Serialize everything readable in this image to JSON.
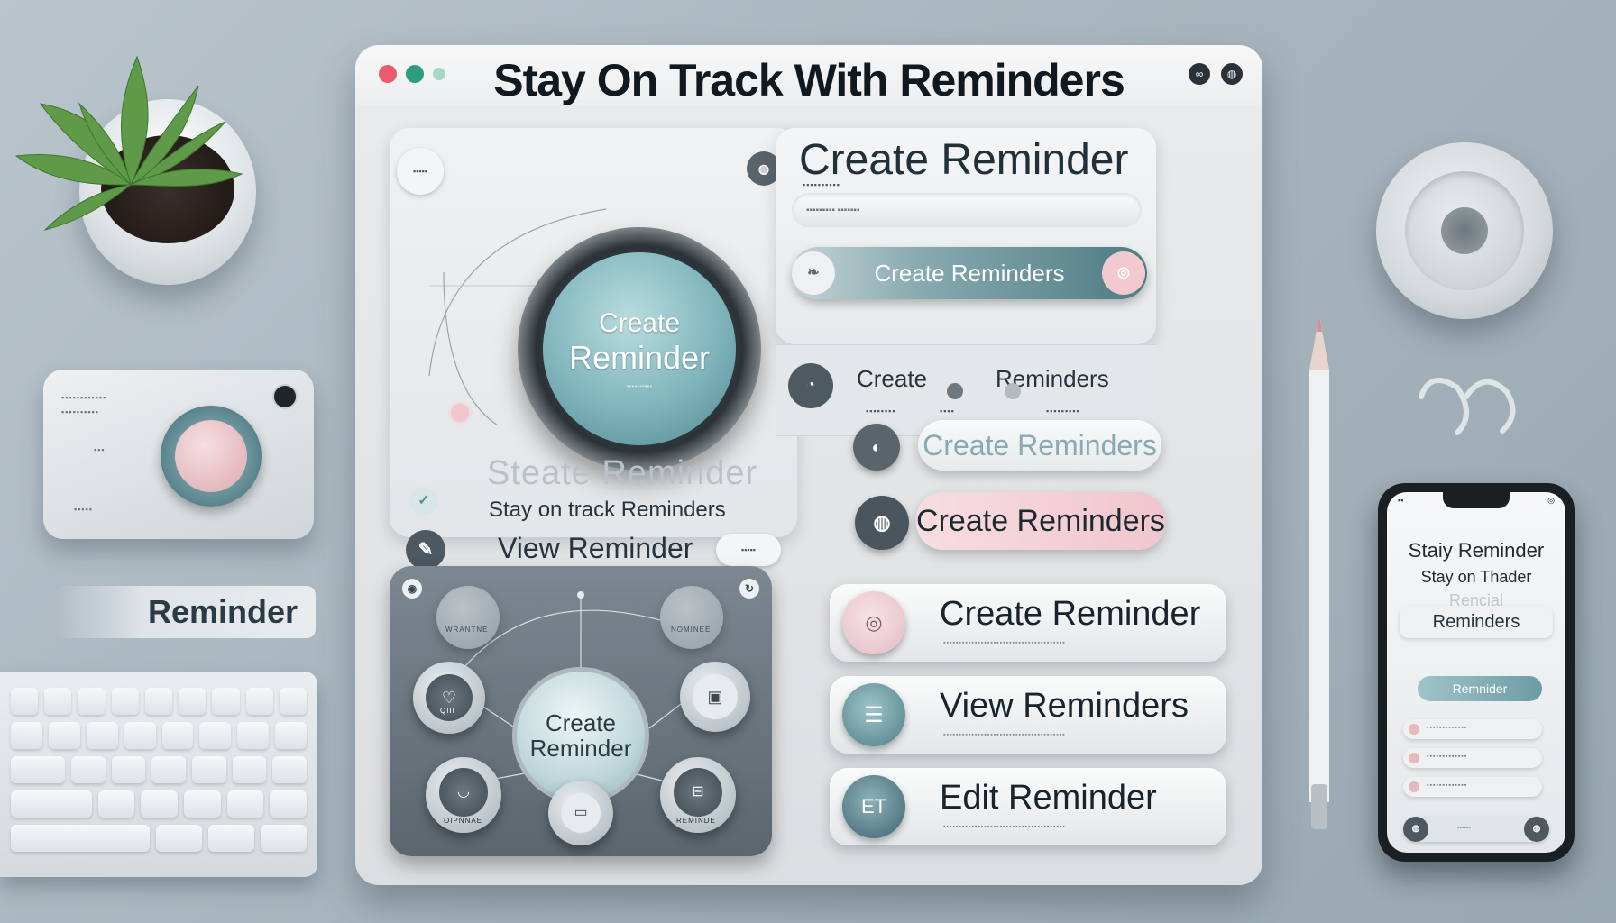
{
  "window": {
    "title": "Stay On Track With Reminders",
    "traffic_lights": [
      "#ea5c6c",
      "#2e9c7e",
      "#a8d8c4"
    ],
    "toolbar_icons": [
      "link-icon",
      "settings-icon"
    ]
  },
  "left_card": {
    "top_pill": "▪▪▪▪▪",
    "big_button": {
      "line1": "Create",
      "line2": "Reminder",
      "sub": "▪▪▪▪▪▪▪▪▪▪"
    },
    "ghost_heading": "Steate Reminder",
    "subtitle": "Stay on track Reminders",
    "view_label": "View Reminder",
    "view_pill": "▪▪▪▪▪"
  },
  "dark_card": {
    "center": {
      "line1": "Create",
      "line2": "Reminder"
    },
    "labels": [
      "WRANTNE",
      "NOMINEE",
      "QIII",
      "OIPNNAE",
      "REMINDE"
    ]
  },
  "right_top": {
    "title": "Create Reminder",
    "field_label": "▪▪▪▪▪▪▪▪▪▪",
    "field_value": "▪▪▪▪▪▪▪▪▪ ▪▪▪▪▪▪▪",
    "gradient_button": "Create Reminders"
  },
  "right_mid": {
    "left_word": "Create",
    "right_word": "Reminders",
    "tiny": [
      "▪▪▪▪▪▪▪▪",
      "▪▪▪▪",
      "▪▪▪▪▪▪▪▪▪"
    ]
  },
  "pill_buttons": [
    {
      "label": "Create  Reminders"
    },
    {
      "label": "Create  Reminders"
    }
  ],
  "list_buttons": [
    {
      "label": "Create Reminder",
      "sub": "▪▪▪▪▪▪▪▪▪▪▪▪▪▪▪▪▪▪▪▪▪▪▪▪▪▪▪▪▪▪▪▪▪▪▪▪▪▪▪",
      "icon": "clock-icon",
      "icon_text": "◎",
      "icon_bg": "#e2bcc3"
    },
    {
      "label": "View Reminders",
      "sub": "▪▪▪▪▪▪▪▪▪▪▪▪▪▪▪▪▪▪▪▪▪▪▪▪▪▪▪▪▪▪▪▪▪▪▪▪▪▪▪",
      "icon": "list-icon",
      "icon_text": "☰",
      "icon_bg": "#5c8d95"
    },
    {
      "label": "Edit  Reminder",
      "sub": "▪▪▪▪▪▪▪▪▪▪▪▪▪▪▪▪▪▪▪▪▪▪▪▪▪▪▪▪▪▪▪▪▪▪▪▪▪▪▪",
      "icon": "edit-icon",
      "icon_text": "ET",
      "icon_bg": "#4d7683"
    }
  ],
  "desk": {
    "camera_text": [
      "▪▪▪▪▪▪▪▪▪▪▪▪",
      "▪▪▪▪▪▪▪▪▪▪",
      "▪▪▪",
      "▪▪▪▪▪"
    ],
    "reminder_chip": "Reminder"
  },
  "phone": {
    "status_left": "▪▪",
    "status_right": "◎",
    "title": "Staiy Reminder",
    "subtitle": "Stay on Thader",
    "ghost": "Rencial",
    "item": "Reminders",
    "button": "Remnider",
    "rows": [
      "▪▪▪▪▪▪▪▪▪▪▪▪▪",
      "▪▪▪▪▪▪▪▪▪▪▪▪▪",
      "▪▪▪▪▪▪▪▪▪▪▪▪▪"
    ],
    "bottom_pill": "▪▪▪▪▪▪"
  },
  "colors": {
    "accent_teal": "#5c8d95",
    "accent_pink": "#f1c9cf",
    "dark_panel": "#5b666f"
  }
}
